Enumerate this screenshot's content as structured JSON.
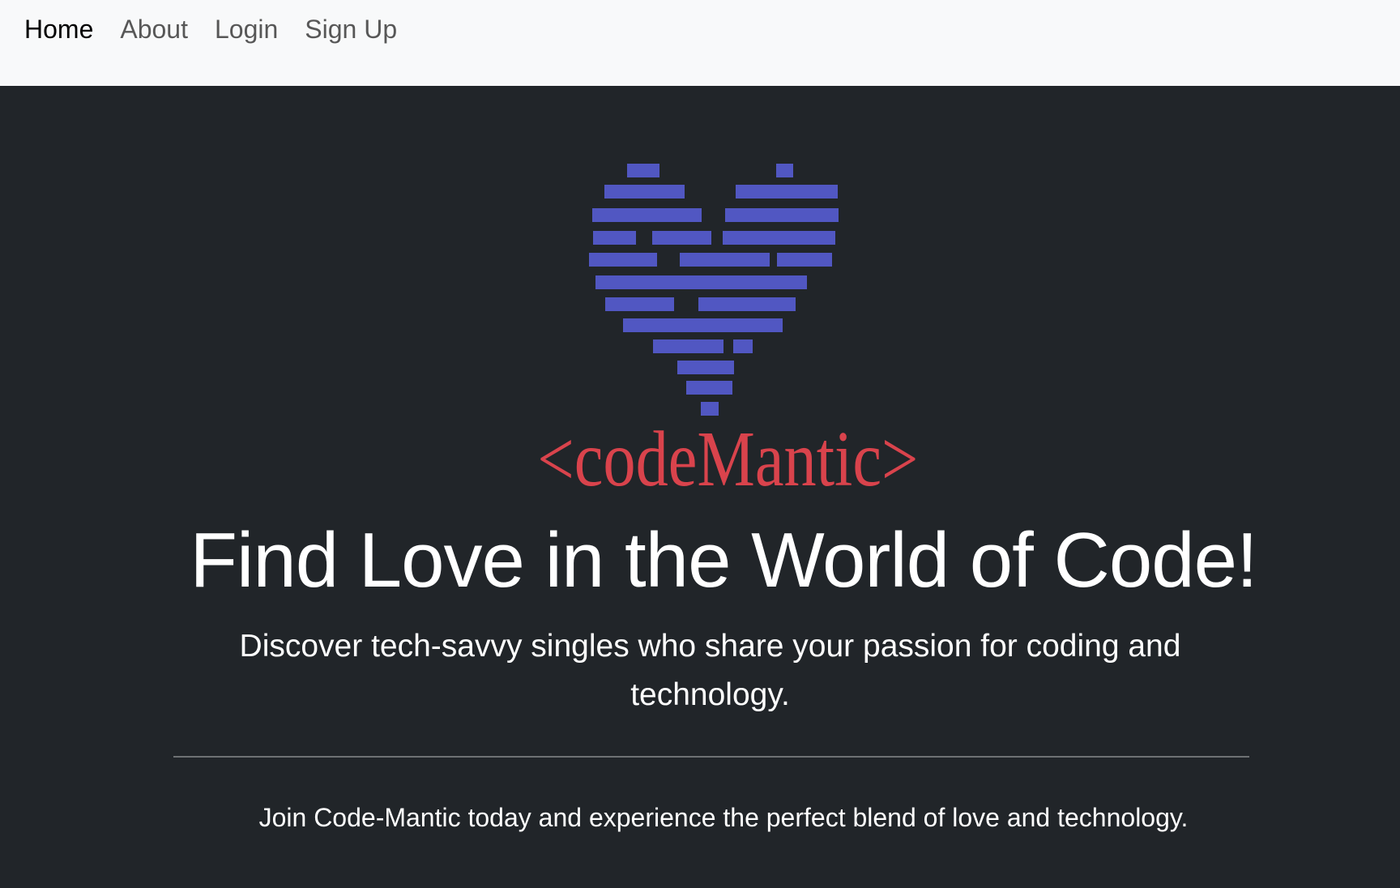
{
  "nav": {
    "items": [
      {
        "label": "Home",
        "active": true
      },
      {
        "label": "About",
        "active": false
      },
      {
        "label": "Login",
        "active": false
      },
      {
        "label": "Sign Up",
        "active": false
      }
    ]
  },
  "hero": {
    "logo_text": "<codeMantic>",
    "headline": "Find Love in the World of Code!",
    "lead": "Discover tech-savvy singles who share your passion for coding and technology.",
    "join": "Join Code-Mantic today and experience the perfect blend of love and technology."
  },
  "colors": {
    "navbar_bg": "#f8f9fa",
    "hero_bg": "#212529",
    "heart": "#5157c2",
    "logo_text": "#d9434c"
  }
}
